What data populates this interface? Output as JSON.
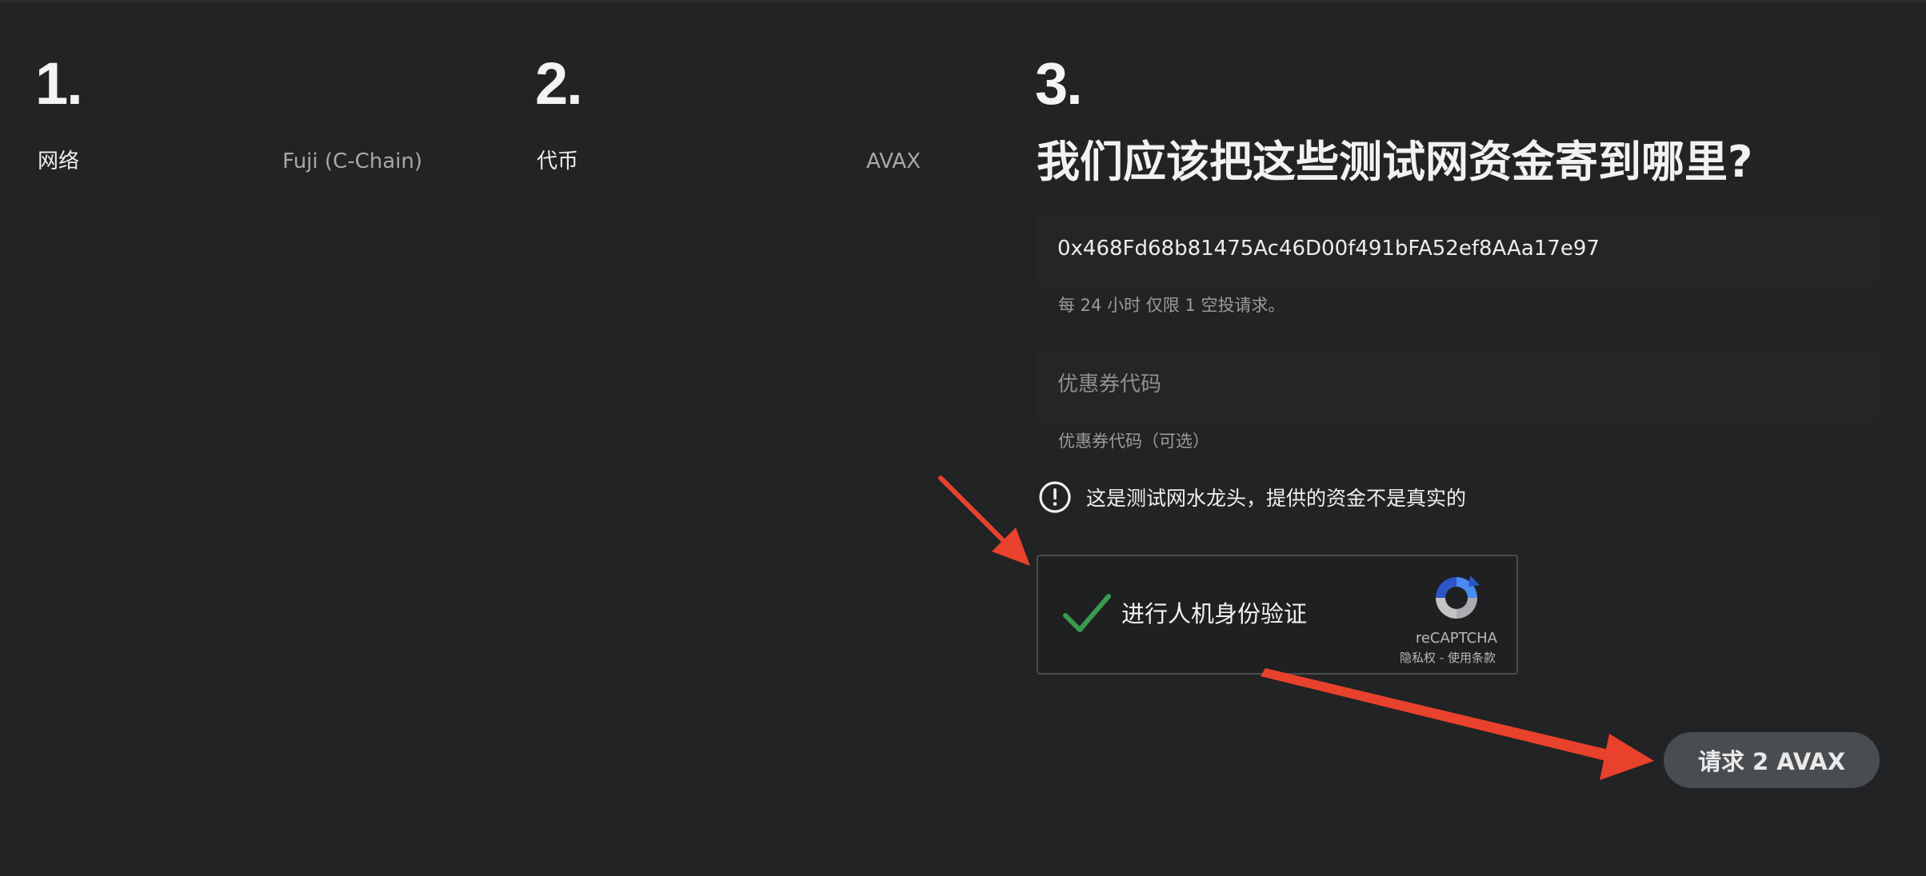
{
  "steps": {
    "one": {
      "number": "1.",
      "label": "网络",
      "value": "Fuji (C-Chain)"
    },
    "two": {
      "number": "2.",
      "label": "代币",
      "value": "AVAX"
    },
    "three": {
      "number": "3.",
      "question": "我们应该把这些测试网资金寄到哪里?"
    }
  },
  "form": {
    "address_value": "0x468Fd68b81475Ac46D00f491bFA52ef8AAa17e97",
    "address_hint": "每 24 小时 仅限 1 空投请求。",
    "coupon_placeholder": "优惠券代码",
    "coupon_hint": "优惠券代码（可选）",
    "warning_text": "这是测试网水龙头，提供的资金不是真实的",
    "captcha": {
      "label": "进行人机身份验证",
      "brand": "reCAPTCHA",
      "terms": "隐私权 - 使用条款",
      "checked": true
    },
    "submit_label": "请求 2 AVAX"
  },
  "icons": {
    "warning": "exclamation-circle-icon",
    "checkmark": "checkmark-icon",
    "recaptcha": "recaptcha-logo-icon",
    "annotation": "arrow-icon"
  },
  "colors": {
    "background": "#222324",
    "check_green": "#3a9a4e",
    "annotation_red": "#e8412c",
    "button_bg": "#4a4d50"
  }
}
